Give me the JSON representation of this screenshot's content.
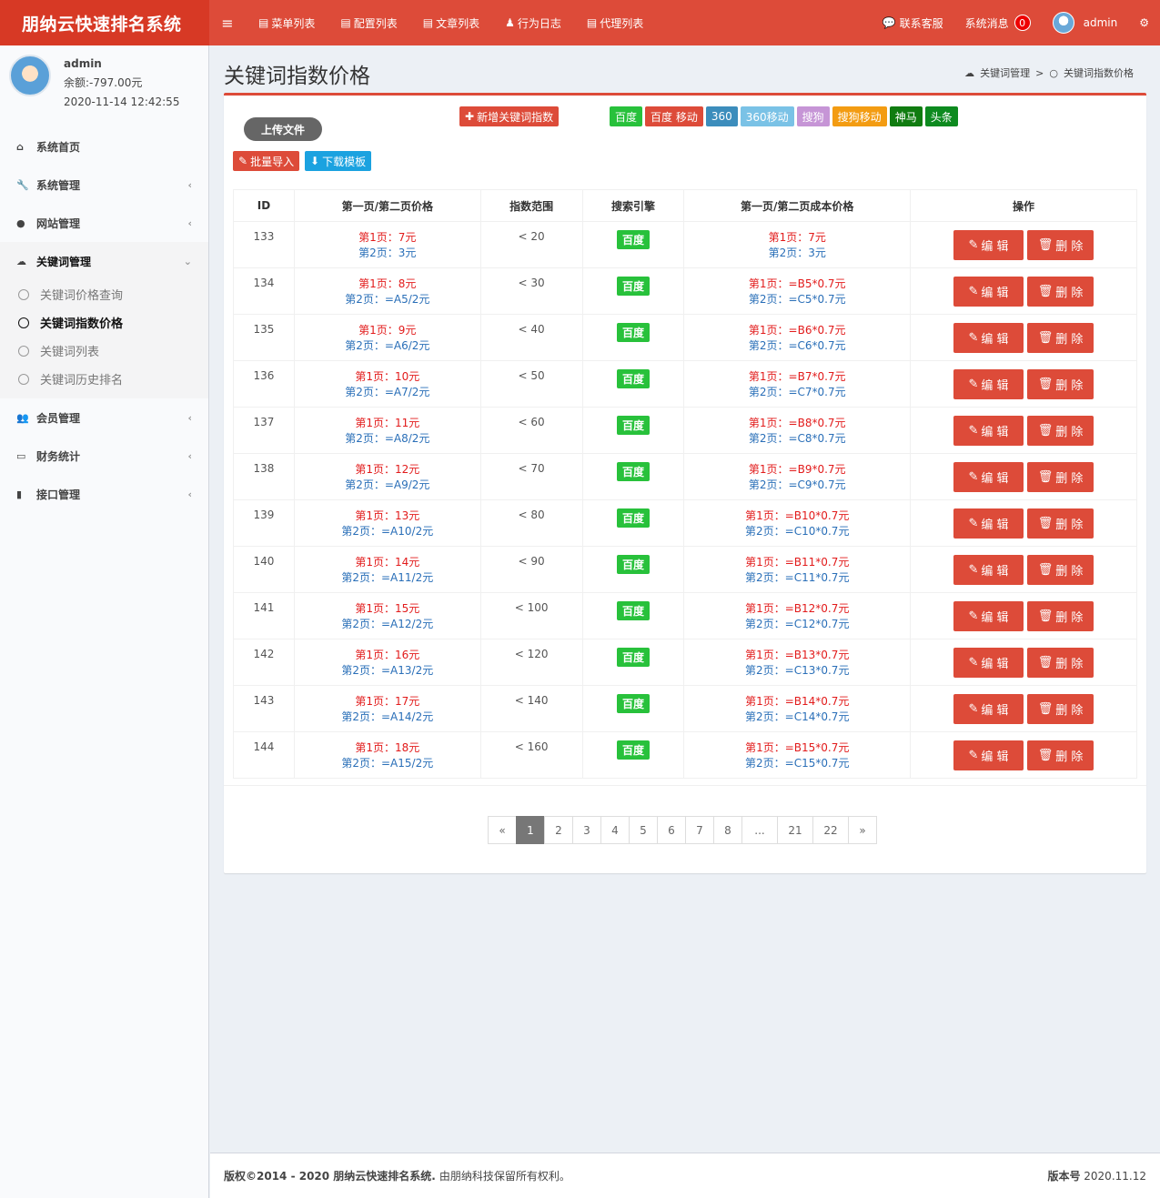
{
  "header": {
    "brand": "朋纳云快速排名系统",
    "nav": [
      "菜单列表",
      "配置列表",
      "文章列表",
      "行为日志",
      "代理列表"
    ],
    "contact": "联系客服",
    "messages_label": "系统消息",
    "messages_count": "0",
    "user": "admin"
  },
  "user_panel": {
    "name": "admin",
    "balance": "余额:-797.00元",
    "time": "2020-11-14 12:42:55"
  },
  "sidebar": {
    "items": [
      {
        "label": "系统首页"
      },
      {
        "label": "系统管理"
      },
      {
        "label": "网站管理"
      },
      {
        "label": "关键词管理"
      },
      {
        "label": "会员管理"
      },
      {
        "label": "财务统计"
      },
      {
        "label": "接口管理"
      }
    ],
    "sub": [
      "关键词价格查询",
      "关键词指数价格",
      "关键词列表",
      "关键词历史排名"
    ]
  },
  "page": {
    "title": "关键词指数价格",
    "breadcrumb_parent": "关键词管理",
    "breadcrumb_sep": ">",
    "breadcrumb_current": "关键词指数价格"
  },
  "toolbar": {
    "upload": "上传文件",
    "add": "新增关键词指数",
    "import": "批量导入",
    "template": "下载模板",
    "engines": [
      {
        "label": "百度",
        "color": "#28c13b"
      },
      {
        "label": "百度 移动",
        "color": "#dd4b39"
      },
      {
        "label": "360",
        "color": "#3c8dbc"
      },
      {
        "label": "360移动",
        "color": "#7ac2e6"
      },
      {
        "label": "搜狗",
        "color": "#c695d6"
      },
      {
        "label": "搜狗移动",
        "color": "#f39c12"
      },
      {
        "label": "神马",
        "color": "#107c10"
      },
      {
        "label": "头条",
        "color": "#0d8a1f"
      }
    ]
  },
  "table": {
    "headers": [
      "ID",
      "第一页/第二页价格",
      "指数范围",
      "搜索引擎",
      "第一页/第二页成本价格",
      "操作"
    ],
    "edit_label": "编 辑",
    "delete_label": "删 除",
    "rows": [
      {
        "id": "133",
        "p1": "第1页：7元",
        "p2": "第2页：3元",
        "range": "< 20",
        "engine": "百度",
        "c1": "第1页：7元",
        "c2": "第2页：3元"
      },
      {
        "id": "134",
        "p1": "第1页：8元",
        "p2": "第2页：=A5/2元",
        "range": "< 30",
        "engine": "百度",
        "c1": "第1页：=B5*0.7元",
        "c2": "第2页：=C5*0.7元"
      },
      {
        "id": "135",
        "p1": "第1页：9元",
        "p2": "第2页：=A6/2元",
        "range": "< 40",
        "engine": "百度",
        "c1": "第1页：=B6*0.7元",
        "c2": "第2页：=C6*0.7元"
      },
      {
        "id": "136",
        "p1": "第1页：10元",
        "p2": "第2页：=A7/2元",
        "range": "< 50",
        "engine": "百度",
        "c1": "第1页：=B7*0.7元",
        "c2": "第2页：=C7*0.7元"
      },
      {
        "id": "137",
        "p1": "第1页：11元",
        "p2": "第2页：=A8/2元",
        "range": "< 60",
        "engine": "百度",
        "c1": "第1页：=B8*0.7元",
        "c2": "第2页：=C8*0.7元"
      },
      {
        "id": "138",
        "p1": "第1页：12元",
        "p2": "第2页：=A9/2元",
        "range": "< 70",
        "engine": "百度",
        "c1": "第1页：=B9*0.7元",
        "c2": "第2页：=C9*0.7元"
      },
      {
        "id": "139",
        "p1": "第1页：13元",
        "p2": "第2页：=A10/2元",
        "range": "< 80",
        "engine": "百度",
        "c1": "第1页：=B10*0.7元",
        "c2": "第2页：=C10*0.7元"
      },
      {
        "id": "140",
        "p1": "第1页：14元",
        "p2": "第2页：=A11/2元",
        "range": "< 90",
        "engine": "百度",
        "c1": "第1页：=B11*0.7元",
        "c2": "第2页：=C11*0.7元"
      },
      {
        "id": "141",
        "p1": "第1页：15元",
        "p2": "第2页：=A12/2元",
        "range": "< 100",
        "engine": "百度",
        "c1": "第1页：=B12*0.7元",
        "c2": "第2页：=C12*0.7元"
      },
      {
        "id": "142",
        "p1": "第1页：16元",
        "p2": "第2页：=A13/2元",
        "range": "< 120",
        "engine": "百度",
        "c1": "第1页：=B13*0.7元",
        "c2": "第2页：=C13*0.7元"
      },
      {
        "id": "143",
        "p1": "第1页：17元",
        "p2": "第2页：=A14/2元",
        "range": "< 140",
        "engine": "百度",
        "c1": "第1页：=B14*0.7元",
        "c2": "第2页：=C14*0.7元"
      },
      {
        "id": "144",
        "p1": "第1页：18元",
        "p2": "第2页：=A15/2元",
        "range": "< 160",
        "engine": "百度",
        "c1": "第1页：=B15*0.7元",
        "c2": "第2页：=C15*0.7元"
      }
    ]
  },
  "pagination": {
    "pages": [
      "«",
      "1",
      "2",
      "3",
      "4",
      "5",
      "6",
      "7",
      "8",
      "...",
      "21",
      "22",
      "»"
    ],
    "current": "1"
  },
  "footer": {
    "copyright_prefix": "版权©2014 - 2020 朋纳云快速排名系统.",
    "copyright_suffix": "由朋纳科技保留所有权利。",
    "version_label": "版本号",
    "version": "2020.11.12"
  },
  "colors": {
    "primary": "#dd4b39",
    "sidebar_bg": "#f9fafc",
    "content_bg": "#ecf0f5"
  }
}
